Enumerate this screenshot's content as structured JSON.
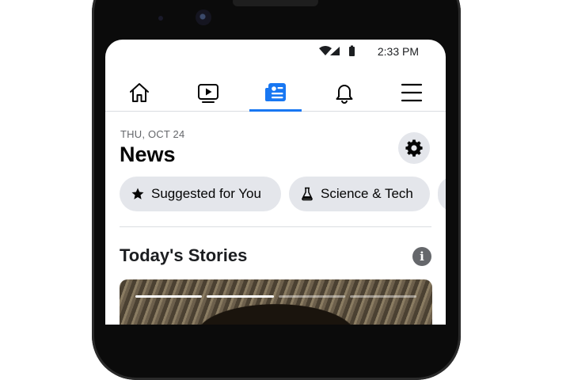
{
  "status_bar": {
    "time": "2:33 PM",
    "icons": [
      "wifi-icon",
      "signal-icon",
      "battery-icon"
    ]
  },
  "nav": {
    "tabs": [
      {
        "name": "home",
        "icon": "home-icon",
        "active": false
      },
      {
        "name": "watch",
        "icon": "video-play-icon",
        "active": false
      },
      {
        "name": "news",
        "icon": "news-icon",
        "active": true
      },
      {
        "name": "notifications",
        "icon": "bell-icon",
        "active": false
      },
      {
        "name": "menu",
        "icon": "hamburger-menu-icon",
        "active": false
      }
    ]
  },
  "header": {
    "date": "THU, OCT 24",
    "title": "News",
    "settings_icon": "gear-icon"
  },
  "chips": [
    {
      "label": "Suggested for You",
      "icon": "star-icon"
    },
    {
      "label": "Science & Tech",
      "icon": "flask-icon"
    },
    {
      "label": "",
      "icon": ""
    }
  ],
  "stories": {
    "title": "Today's Stories",
    "info_icon": "info-icon",
    "progress_total": 4,
    "progress_current": 2
  },
  "colors": {
    "accent": "#1877f2",
    "chip_bg": "#e4e6eb",
    "muted_text": "#65676b"
  }
}
